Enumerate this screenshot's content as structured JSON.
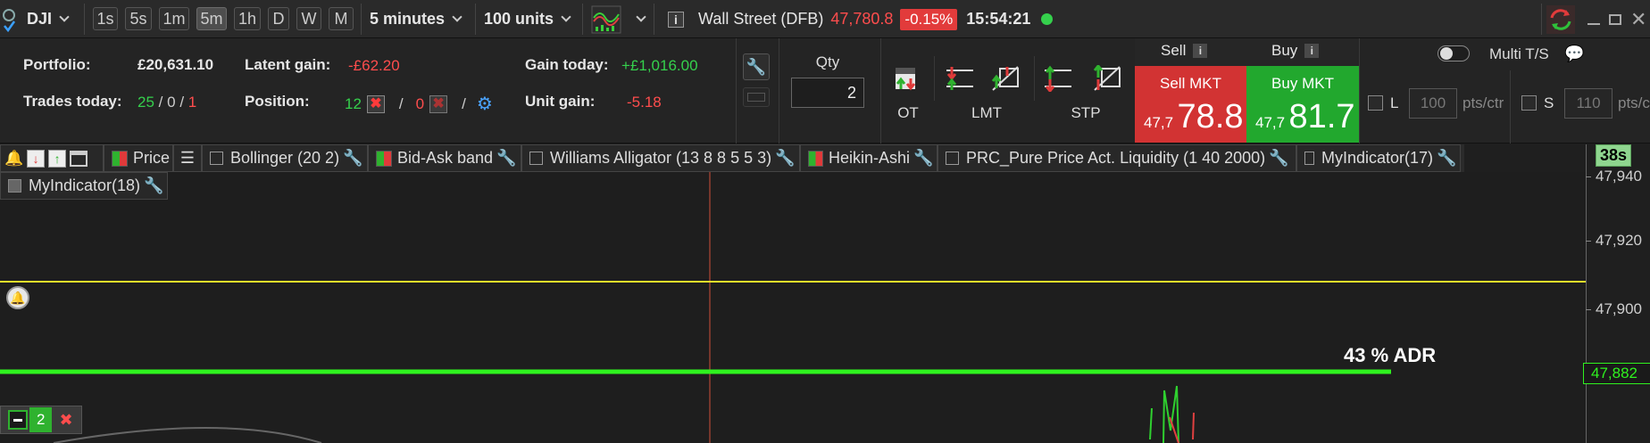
{
  "topbar": {
    "instrument": "DJI",
    "timeframes": [
      "1s",
      "5s",
      "1m",
      "5m",
      "1h",
      "D",
      "W",
      "M"
    ],
    "active_timeframe": "5m",
    "interval": "5 minutes",
    "units": "100 units",
    "market_name": "Wall Street (DFB)",
    "price": "47,780.8",
    "change": "-0.15%",
    "time": "15:54:21",
    "status_color": "#35d04c"
  },
  "panel": {
    "portfolio_label": "Portfolio:",
    "portfolio_value": "£20,631.10",
    "latent_label": "Latent gain:",
    "latent_value": "-£62.20",
    "gain_today_label": "Gain today:",
    "gain_today_value": "+£1,016.00",
    "trades_label": "Trades today:",
    "trades_a": "25",
    "trades_b": "0",
    "trades_c": "1",
    "slash": "/",
    "position_label": "Position:",
    "position_long": "12",
    "position_short": "0",
    "unit_gain_label": "Unit gain:",
    "unit_gain_value": "-5.18",
    "qty_label": "Qty",
    "qty_value": "2",
    "ot_label": "OT",
    "lmt_label": "LMT",
    "stp_label": "STP",
    "sell_label": "Sell",
    "buy_label": "Buy",
    "sell_mkt_label": "Sell MKT",
    "buy_mkt_label": "Buy MKT",
    "sell_price_prefix": "47,7",
    "sell_price_main": "78.8",
    "buy_price_prefix": "47,7",
    "buy_price_main": "81.7",
    "multi_ts_label": "Multi T/S",
    "l_label": "L",
    "l_value": "100",
    "s_label": "S",
    "s_value": "110",
    "pts_label": "pts/ctr"
  },
  "indicators": {
    "price": "Price",
    "bollinger": "Bollinger (20 2)",
    "bidask": "Bid-Ask band",
    "williams": "Williams Alligator (13 8 8 5 5 3)",
    "heikin": "Heikin-Ashi",
    "prc": "PRC_Pure Price Act. Liquidity (1 40 2000)",
    "myind17": "MyIndicator(17)",
    "myind18": "MyIndicator(18)"
  },
  "chart": {
    "countdown": "38s",
    "adr_label": "43 % ADR",
    "adr_level": "47,882",
    "position_badge_count": "2",
    "y_ticks": [
      "47,940",
      "47,920",
      "47,900"
    ],
    "hline_yellow_color": "#e6e12a",
    "adr_line_color": "#2ff21f",
    "crosshair_color": "#d0503a"
  }
}
